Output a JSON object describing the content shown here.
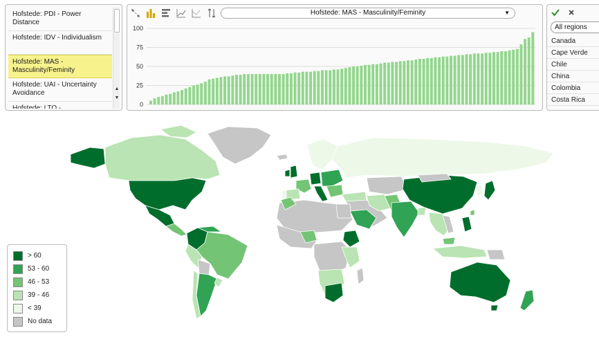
{
  "indicators": [
    {
      "label": "Hofstede: PDI - Power Distance",
      "selected": false
    },
    {
      "label": "Hofstede: IDV - Individualism",
      "selected": false
    },
    {
      "label": "Hofstede: MAS - Masculinity/Feminity",
      "selected": true
    },
    {
      "label": "Hofstede: UAI - Uncertainty Avoidance",
      "selected": false
    },
    {
      "label": "Hofstede: LTO - ...",
      "selected": false
    }
  ],
  "toolbar": {
    "icons": [
      "scatter-plot-icon",
      "bar-chart-icon",
      "horizontal-bar-icon",
      "line-chart-icon",
      "trend-chart-icon",
      "sort-icon"
    ],
    "active_icon": "bar-chart-icon",
    "indicator_select": "Hofstede: MAS - Masculinity/Feminity"
  },
  "regions": {
    "filter_value": "All regions",
    "items": [
      "Canada",
      "Cape Verde",
      "Chile",
      "China",
      "Colombia",
      "Costa Rica"
    ]
  },
  "chart_data": {
    "type": "bar",
    "title": "",
    "xlabel": "",
    "ylabel": "",
    "ylim": [
      0,
      100
    ],
    "yticks": [
      0,
      25,
      50,
      75,
      100
    ],
    "color": "#93d68d",
    "sorted": "ascending",
    "values": [
      5,
      8,
      10,
      11,
      13,
      14,
      16,
      17,
      19,
      21,
      23,
      25,
      26,
      28,
      30,
      33,
      34,
      35,
      36,
      37,
      37,
      38,
      39,
      39,
      40,
      40,
      40,
      40,
      40,
      40,
      40,
      40,
      40,
      40,
      40,
      41,
      41,
      42,
      42,
      43,
      43,
      43,
      44,
      44,
      45,
      45,
      45,
      46,
      46,
      47,
      48,
      49,
      50,
      50,
      51,
      52,
      52,
      53,
      53,
      54,
      55,
      55,
      56,
      56,
      57,
      57,
      58,
      58,
      59,
      60,
      60,
      61,
      61,
      62,
      62,
      63,
      63,
      64,
      64,
      65,
      65,
      66,
      66,
      67,
      67,
      67,
      68,
      68,
      69,
      69,
      70,
      70,
      71,
      72,
      73,
      79,
      86,
      88,
      95
    ]
  },
  "map": {
    "colors": {
      "gt60": "#006d2c",
      "53_60": "#31a354",
      "46_53": "#74c476",
      "39_46": "#bae4b3",
      "lt39": "#edf8e9",
      "nodata": "#c6c6c6"
    }
  },
  "legend": [
    {
      "label": "> 60",
      "color": "#006d2c"
    },
    {
      "label": "53 - 60",
      "color": "#31a354"
    },
    {
      "label": "46 - 53",
      "color": "#74c476"
    },
    {
      "label": "39 - 46",
      "color": "#bae4b3"
    },
    {
      "label": "< 39",
      "color": "#edf8e9"
    },
    {
      "label": "No data",
      "color": "#c6c6c6"
    }
  ]
}
